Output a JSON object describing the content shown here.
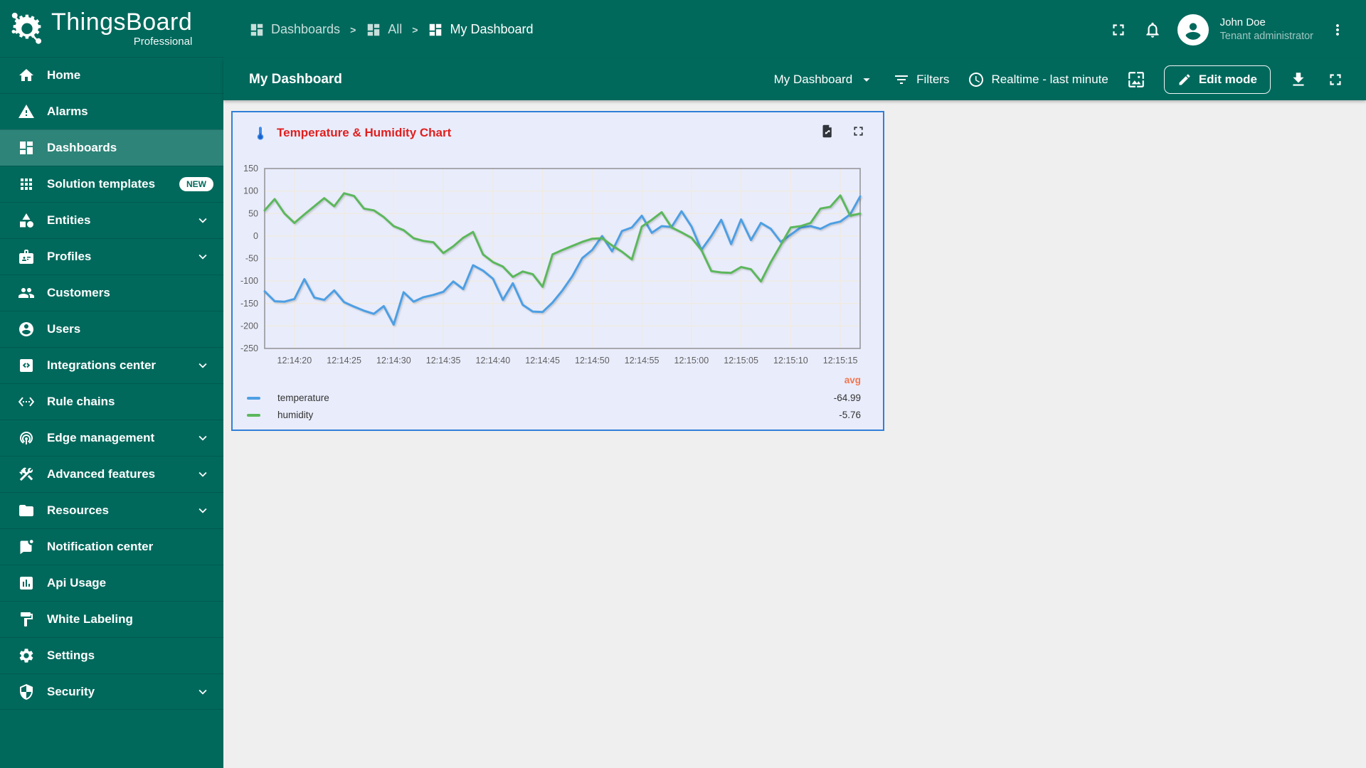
{
  "app": {
    "name": "ThingsBoard",
    "edition": "Professional"
  },
  "colors": {
    "primary_teal": "#00695C",
    "content_bg": "#EFEFEF",
    "widget_bg": "#E9ECFB",
    "widget_selection_border": "#2F80D9",
    "widget_title": "#E01F1F",
    "avg_header": "#F2764E",
    "temperature_line": "#4E9FE3",
    "humidity_line": "#5CB75C"
  },
  "breadcrumb": {
    "separator": ">",
    "items": [
      {
        "label": "Dashboards",
        "icon": "dashboards",
        "current": false
      },
      {
        "label": "All",
        "icon": "dashboards",
        "current": false
      },
      {
        "label": "My Dashboard",
        "icon": "dashboards",
        "current": true
      }
    ]
  },
  "header": {
    "user": {
      "name": "John Doe",
      "role": "Tenant administrator"
    }
  },
  "toolbar": {
    "title": "My Dashboard",
    "state_selector": "My Dashboard",
    "filters_label": "Filters",
    "time_window": "Realtime - last minute",
    "edit_button": "Edit mode"
  },
  "sidebar": {
    "items": [
      {
        "label": "Home",
        "icon": "home"
      },
      {
        "label": "Alarms",
        "icon": "alarms"
      },
      {
        "label": "Dashboards",
        "icon": "dashboards",
        "selected": true
      },
      {
        "label": "Solution templates",
        "icon": "solution-templates",
        "badge": "NEW"
      },
      {
        "label": "Entities",
        "icon": "entities",
        "expandable": true
      },
      {
        "label": "Profiles",
        "icon": "profiles",
        "expandable": true
      },
      {
        "label": "Customers",
        "icon": "customers"
      },
      {
        "label": "Users",
        "icon": "users"
      },
      {
        "label": "Integrations center",
        "icon": "integrations-center",
        "expandable": true
      },
      {
        "label": "Rule chains",
        "icon": "rule-chains"
      },
      {
        "label": "Edge management",
        "icon": "edge-management",
        "expandable": true
      },
      {
        "label": "Advanced features",
        "icon": "advanced-features",
        "expandable": true
      },
      {
        "label": "Resources",
        "icon": "resources",
        "expandable": true
      },
      {
        "label": "Notification center",
        "icon": "notification-center"
      },
      {
        "label": "Api Usage",
        "icon": "api-usage"
      },
      {
        "label": "White Labeling",
        "icon": "white-labeling"
      },
      {
        "label": "Settings",
        "icon": "settings"
      },
      {
        "label": "Security",
        "icon": "security",
        "expandable": true
      }
    ]
  },
  "widget": {
    "title": "Temperature & Humidity Chart",
    "legend": {
      "header": "avg",
      "rows": [
        {
          "label": "temperature",
          "value": "-64.99",
          "color": "#4E9FE3"
        },
        {
          "label": "humidity",
          "value": "-5.76",
          "color": "#5CB75C"
        }
      ]
    }
  },
  "chart_data": {
    "type": "line",
    "title": "Temperature & Humidity Chart",
    "xlabel": "",
    "ylabel": "",
    "ylim": [
      -250,
      150
    ],
    "yticks": [
      150,
      100,
      50,
      0,
      -50,
      -100,
      -150,
      -200,
      -250
    ],
    "xtick_labels": [
      "12:14:20",
      "12:14:25",
      "12:14:30",
      "12:14:35",
      "12:14:40",
      "12:14:45",
      "12:14:50",
      "12:14:55",
      "12:15:00",
      "12:15:05",
      "12:15:10",
      "12:15:15"
    ],
    "grid": true,
    "legend_position": "bottom",
    "x_times": [
      "12:14:17",
      "12:14:18",
      "12:14:19",
      "12:14:20",
      "12:14:21",
      "12:14:22",
      "12:14:23",
      "12:14:24",
      "12:14:25",
      "12:14:26",
      "12:14:27",
      "12:14:28",
      "12:14:29",
      "12:14:30",
      "12:14:31",
      "12:14:32",
      "12:14:33",
      "12:14:34",
      "12:14:35",
      "12:14:36",
      "12:14:37",
      "12:14:38",
      "12:14:39",
      "12:14:40",
      "12:14:41",
      "12:14:42",
      "12:14:43",
      "12:14:44",
      "12:14:45",
      "12:14:46",
      "12:14:47",
      "12:14:48",
      "12:14:49",
      "12:14:50",
      "12:14:51",
      "12:14:52",
      "12:14:53",
      "12:14:54",
      "12:14:55",
      "12:14:56",
      "12:14:57",
      "12:14:58",
      "12:14:59",
      "12:15:00",
      "12:15:01",
      "12:15:02",
      "12:15:03",
      "12:15:04",
      "12:15:05",
      "12:15:06",
      "12:15:07",
      "12:15:08",
      "12:15:09",
      "12:15:10",
      "12:15:11",
      "12:15:12",
      "12:15:13",
      "12:15:14",
      "12:15:15",
      "12:15:16",
      "12:15:17"
    ],
    "series": [
      {
        "name": "temperature",
        "color": "#4E9FE3",
        "avg": -64.99,
        "values": [
          -123,
          -145,
          -146,
          -140,
          -96,
          -137,
          -142,
          -121,
          -147,
          -157,
          -166,
          -173,
          -156,
          -197,
          -125,
          -146,
          -136,
          -131,
          -124,
          -101,
          -118,
          -65,
          -77,
          -95,
          -142,
          -105,
          -153,
          -168,
          -169,
          -148,
          -121,
          -89,
          -49,
          -31,
          0,
          -34,
          11,
          19,
          45,
          7,
          22,
          20,
          55,
          21,
          -31,
          0,
          36,
          -18,
          37,
          -9,
          29,
          16,
          -13,
          3,
          19,
          22,
          16,
          27,
          32,
          48,
          88
        ]
      },
      {
        "name": "humidity",
        "color": "#5CB75C",
        "avg": -5.76,
        "values": [
          57,
          82,
          50,
          29,
          48,
          66,
          84,
          66,
          95,
          89,
          61,
          57,
          42,
          22,
          13,
          -5,
          -11,
          -14,
          -38,
          -23,
          -4,
          9,
          -41,
          -58,
          -68,
          -91,
          -79,
          -85,
          -113,
          -41,
          -31,
          -22,
          -13,
          -6,
          -5,
          -21,
          -35,
          -52,
          21,
          36,
          53,
          19,
          8,
          -4,
          -31,
          -78,
          -81,
          -82,
          -69,
          -74,
          -101,
          -58,
          -20,
          19,
          22,
          29,
          61,
          65,
          90,
          45,
          50
        ]
      }
    ]
  }
}
